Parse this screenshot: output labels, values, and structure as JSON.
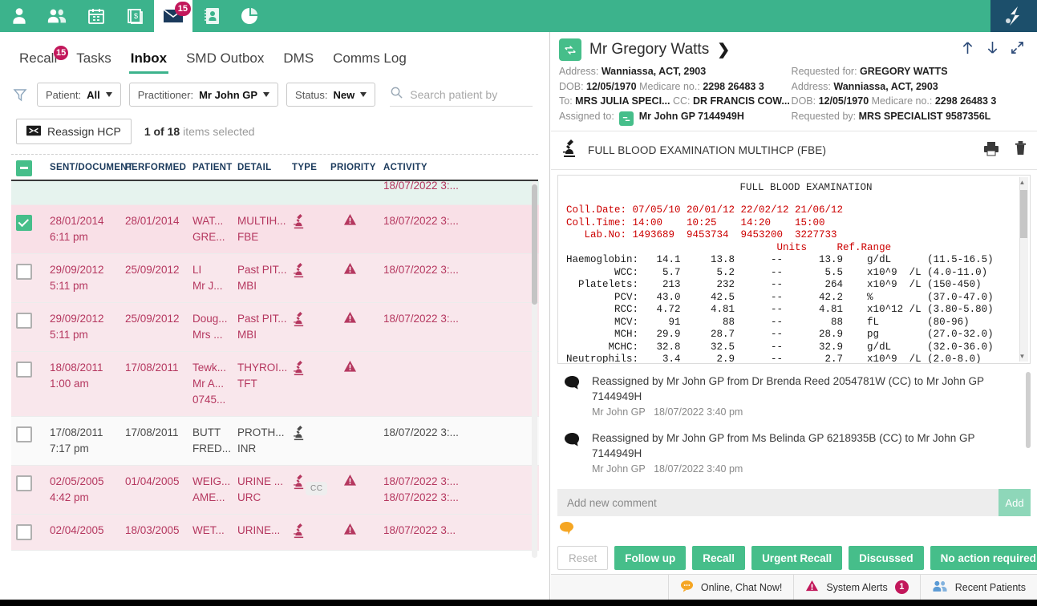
{
  "colors": {
    "brand_green": "#3cb38c",
    "accent_green": "#46be8a",
    "crimson": "#c2185b",
    "pink_row": "#f9e7ec",
    "lab_red": "#cc0000",
    "logo_navy": "#1c4f6b"
  },
  "topnav": {
    "items": [
      {
        "name": "patient-icon",
        "label": "Patient",
        "active": false,
        "badge": ""
      },
      {
        "name": "patients-group-icon",
        "label": "Patients",
        "active": false,
        "badge": ""
      },
      {
        "name": "calendar-icon",
        "label": "Appointments",
        "active": false,
        "badge": ""
      },
      {
        "name": "billing-icon",
        "label": "Billing",
        "active": false,
        "badge": ""
      },
      {
        "name": "inbox-mail-icon",
        "label": "Inbox",
        "active": true,
        "badge": "15"
      },
      {
        "name": "address-book-icon",
        "label": "Address Book",
        "active": false,
        "badge": ""
      },
      {
        "name": "reports-pie-icon",
        "label": "Reports",
        "active": false,
        "badge": ""
      }
    ]
  },
  "tabs": [
    {
      "label": "Recall",
      "badge": "15",
      "active": false
    },
    {
      "label": "Tasks",
      "badge": "",
      "active": false
    },
    {
      "label": "Inbox",
      "badge": "",
      "active": true
    },
    {
      "label": "SMD Outbox",
      "badge": "",
      "active": false
    },
    {
      "label": "DMS",
      "badge": "",
      "active": false
    },
    {
      "label": "Comms Log",
      "badge": "",
      "active": false
    }
  ],
  "filters": [
    {
      "prefix": "Patient:",
      "value": "All"
    },
    {
      "prefix": "Practitioner:",
      "value": "Mr John GP"
    },
    {
      "prefix": "Status:",
      "value": "New"
    }
  ],
  "search": {
    "placeholder": "Search patient by",
    "value": ""
  },
  "actionbar": {
    "reassign_label": "Reassign HCP",
    "selection_count": "1 of 18",
    "selection_suffix": "items selected"
  },
  "table": {
    "columns": [
      "SENT/DOCUMENT",
      "PERFORMED",
      "PATIENT",
      "DETAIL",
      "TYPE",
      "PRIORITY",
      "ACTIVITY"
    ],
    "rows": [
      {
        "state": "hovered",
        "checked": false,
        "partial_top": true,
        "sent": "",
        "sent_time": "",
        "performed": "",
        "patient": "",
        "patient_sub": "",
        "patient_sub2": "",
        "detail": "",
        "detail_sub": "",
        "type_icon": "",
        "priority_icon": "",
        "activity": "18/07/2022 3:...",
        "activity2": "",
        "cc": false
      },
      {
        "state": "selected",
        "checked": true,
        "partial_top": false,
        "sent": "28/01/2014",
        "sent_time": "6:11 pm",
        "performed": "28/01/2014",
        "patient": "WAT...",
        "patient_sub": "GRE...",
        "patient_sub2": "",
        "detail": "MULTIH...",
        "detail_sub": "FBE",
        "type_icon": "microscope-icon",
        "priority_icon": "warning-icon",
        "activity": "18/07/2022 3:...",
        "activity2": "",
        "cc": false
      },
      {
        "state": "pink",
        "checked": false,
        "partial_top": false,
        "sent": "29/09/2012",
        "sent_time": "5:11 pm",
        "performed": "25/09/2012",
        "patient": "LI",
        "patient_sub": "Mr J...",
        "patient_sub2": "",
        "detail": "Past PIT...",
        "detail_sub": "MBI",
        "type_icon": "microscope-icon",
        "priority_icon": "warning-icon",
        "activity": "18/07/2022 3:...",
        "activity2": "",
        "cc": false
      },
      {
        "state": "pink",
        "checked": false,
        "partial_top": false,
        "sent": "29/09/2012",
        "sent_time": "5:11 pm",
        "performed": "25/09/2012",
        "patient": "Doug...",
        "patient_sub": "Mrs ...",
        "patient_sub2": "",
        "detail": "Past PIT...",
        "detail_sub": "MBI",
        "type_icon": "microscope-icon",
        "priority_icon": "warning-icon",
        "activity": "18/07/2022 3:...",
        "activity2": "",
        "cc": false
      },
      {
        "state": "pink",
        "checked": false,
        "partial_top": false,
        "sent": "18/08/2011",
        "sent_time": "1:00 am",
        "performed": "17/08/2011",
        "patient": "Tewk...",
        "patient_sub": "Mr A...",
        "patient_sub2": "0745...",
        "detail": "THYROI...",
        "detail_sub": "TFT",
        "type_icon": "microscope-icon",
        "priority_icon": "warning-icon",
        "activity": "",
        "activity2": "",
        "cc": false
      },
      {
        "state": "white",
        "checked": false,
        "partial_top": false,
        "sent": "17/08/2011",
        "sent_time": "7:17 pm",
        "performed": "17/08/2011",
        "patient": "BUTT",
        "patient_sub": "FRED...",
        "patient_sub2": "",
        "detail": "PROTH...",
        "detail_sub": "INR",
        "type_icon": "microscope-icon",
        "priority_icon": "",
        "activity": "18/07/2022 3:...",
        "activity2": "",
        "cc": false
      },
      {
        "state": "pink",
        "checked": false,
        "partial_top": false,
        "sent": "02/05/2005",
        "sent_time": "4:42 pm",
        "performed": "01/04/2005",
        "patient": "WEIG...",
        "patient_sub": "AME...",
        "patient_sub2": "",
        "detail": "URINE ...",
        "detail_sub": "URC",
        "type_icon": "microscope-icon",
        "priority_icon": "warning-icon",
        "activity": "18/07/2022 3:...",
        "activity2": "18/07/2022 3:...",
        "cc": true
      },
      {
        "state": "pink",
        "checked": false,
        "partial_top": false,
        "sent": "02/04/2005",
        "sent_time": "",
        "performed": "18/03/2005",
        "patient": "WET...",
        "patient_sub": "",
        "patient_sub2": "",
        "detail": "URINE...",
        "detail_sub": "",
        "type_icon": "microscope-icon",
        "priority_icon": "warning-icon",
        "activity": "18/07/2022 3...",
        "activity2": "",
        "cc": false
      }
    ]
  },
  "detail": {
    "patient_name": "Mr Gregory Watts",
    "left_meta": [
      {
        "label": "Address:",
        "value": "Wanniassa, ACT, 2903"
      },
      {
        "label": "DOB:",
        "value": "12/05/1970",
        "label2": "Medicare no.:",
        "value2": "2298 26483 3"
      },
      {
        "label": "To:",
        "value": "MRS JULIA SPECI...",
        "label2": "CC:",
        "value2": "DR FRANCIS COW..."
      },
      {
        "label": "Assigned to:",
        "value": "Mr John GP 7144949H",
        "icon": "swap-icon"
      }
    ],
    "right_meta": [
      {
        "label": "Requested for:",
        "value": "GREGORY WATTS"
      },
      {
        "label": "Address:",
        "value": "Wanniassa, ACT, 2903"
      },
      {
        "label": "DOB:",
        "value": "12/05/1970",
        "label2": "Medicare no.:",
        "value2": "2298 26483 3"
      },
      {
        "label": "Requested by:",
        "value": "MRS SPECIALIST 9587356L"
      }
    ],
    "header_icons": [
      "arrow-up-icon",
      "arrow-down-icon",
      "expand-icon"
    ],
    "document_title": "FULL BLOOD EXAMINATION MULTIHCP (FBE)",
    "document_icons": [
      "print-icon",
      "delete-icon"
    ]
  },
  "lab_report": {
    "title": "FULL BLOOD EXAMINATION",
    "meta_lines": [
      "Coll.Date: 07/05/10 20/01/12 22/02/12 21/06/12",
      "Coll.Time: 14:00    10:25    14:20    15:00",
      "   Lab.No: 1493689  9453734  9453200  3227733"
    ],
    "units_header": "                                   Units     Ref.Range",
    "data_lines": [
      "Haemoglobin:   14.1     13.8      --      13.9    g/dL      (11.5-16.5)",
      "        WCC:    5.7      5.2      --       5.5    x10^9  /L (4.0-11.0)",
      "  Platelets:    213      232      --       264    x10^9  /L (150-450)",
      "        PCV:   43.0     42.5      --      42.2    %         (37.0-47.0)",
      "        RCC:   4.72     4.81      --      4.81    x10^12 /L (3.80-5.80)",
      "        MCV:     91       88      --        88    fL        (80-96)",
      "        MCH:   29.9     28.7      --      28.9    pg        (27.0-32.0)",
      "       MCHC:   32.8     32.5      --      32.9    g/dL      (32.0-36.0)",
      "Neutrophils:    3.4      2.9      --       2.7    x10^9  /L (2.0-8.0)"
    ]
  },
  "comments": [
    {
      "text": "Reassigned by Mr John GP from Dr Brenda Reed 2054781W (CC) to Mr John GP 7144949H",
      "author": "Mr John GP",
      "timestamp": "18/07/2022 3:40 pm"
    },
    {
      "text": "Reassigned by Mr John GP from Ms Belinda GP 6218935B (CC) to Mr John GP 7144949H",
      "author": "Mr John GP",
      "timestamp": "18/07/2022 3:40 pm"
    }
  ],
  "comment_box": {
    "placeholder": "Add new comment",
    "value": "",
    "add_label": "Add"
  },
  "action_buttons": [
    {
      "label": "Reset",
      "style": "reset"
    },
    {
      "label": "Follow up",
      "style": "green"
    },
    {
      "label": "Recall",
      "style": "green"
    },
    {
      "label": "Urgent Recall",
      "style": "green"
    },
    {
      "label": "Discussed",
      "style": "green"
    },
    {
      "label": "No action required",
      "style": "green"
    }
  ],
  "status_bar": [
    {
      "label": "Online, Chat Now!",
      "icon": "chat-icon",
      "badge": ""
    },
    {
      "label": "System Alerts",
      "icon": "alert-icon",
      "badge": "1"
    },
    {
      "label": "Recent Patients",
      "icon": "recent-patients-icon",
      "badge": ""
    }
  ]
}
